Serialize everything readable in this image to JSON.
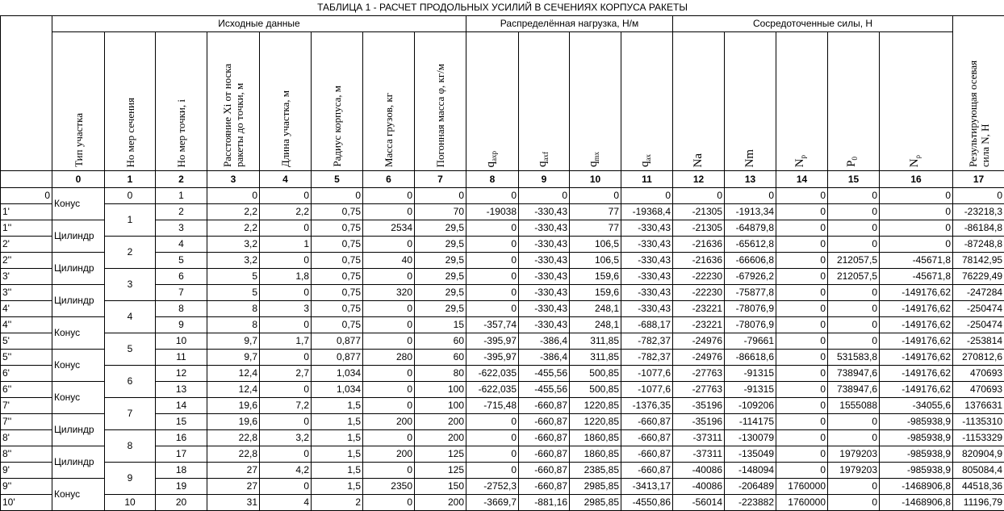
{
  "title": "ТАБЛИЦА 1  - РАСЧЕТ ПРОДОЛЬНЫХ УСИЛИЙ В СЕЧЕНИЯХ КОРПУСА РАКЕТЫ",
  "groups": {
    "source": "Исходные данные",
    "distributed": "Распределённая нагрузка, Н/м",
    "concentrated": "Сосредоточенные силы, Н"
  },
  "headers": [
    {
      "text": "Тип участка"
    },
    {
      "text": "Но мер сечения"
    },
    {
      "text": "Но мер точки, i"
    },
    {
      "text": "Расстояние Xi от носка ракеты до точки, м"
    },
    {
      "text": "Длина участка, м"
    },
    {
      "text": "Радиус корпуса, м"
    },
    {
      "text": "Масса грузов, кг"
    },
    {
      "text": "Погонная масса φ, кг/м"
    },
    {
      "base": "q",
      "sub": "axp"
    },
    {
      "base": "q",
      "sub": "axf"
    },
    {
      "base": "q",
      "sub": "mx"
    },
    {
      "base": "q",
      "sub": "ax"
    },
    {
      "base": "Na",
      "sub": ""
    },
    {
      "base": "Nm",
      "sub": ""
    },
    {
      "base": "N",
      "sub": "p"
    },
    {
      "base": "P",
      "sub": "0"
    },
    {
      "base": "N",
      "sub": "ρ"
    },
    {
      "text": "Результирующая осевая сила N, Н"
    }
  ],
  "index_row": [
    "0",
    "1",
    "2",
    "3",
    "4",
    "5",
    "6",
    "7",
    "8",
    "9",
    "10",
    "11",
    "12",
    "13",
    "14",
    "15",
    "16",
    "17"
  ],
  "segment_types": [
    "Конус",
    "Цилиндр",
    "Цилиндр",
    "Цилиндр",
    "Конус",
    "Конус",
    "Конус",
    "Цилиндр",
    "Цилиндр",
    "Конус"
  ],
  "sections": [
    "0",
    "1",
    "2",
    "3",
    "4",
    "5",
    "6",
    "7",
    "8",
    "9",
    "10"
  ],
  "rows": [
    {
      "label": "0",
      "point": "1",
      "v": [
        "0",
        "0",
        "0",
        "0",
        "0",
        "0",
        "0",
        "0",
        "0",
        "0",
        "0",
        "0",
        "0",
        "0",
        "0"
      ]
    },
    {
      "label": "1'",
      "point": "2",
      "v": [
        "2,2",
        "2,2",
        "0,75",
        "0",
        "70",
        "-19038",
        "-330,43",
        "77",
        "-19368,4",
        "-21305",
        "-1913,34",
        "0",
        "0",
        "0",
        "-23218,3"
      ]
    },
    {
      "label": "1''",
      "point": "3",
      "v": [
        "2,2",
        "0",
        "0,75",
        "2534",
        "29,5",
        "0",
        "-330,43",
        "77",
        "-330,43",
        "-21305",
        "-64879,8",
        "0",
        "0",
        "0",
        "-86184,8"
      ]
    },
    {
      "label": "2'",
      "point": "4",
      "v": [
        "3,2",
        "1",
        "0,75",
        "0",
        "29,5",
        "0",
        "-330,43",
        "106,5",
        "-330,43",
        "-21636",
        "-65612,8",
        "0",
        "0",
        "0",
        "-87248,8"
      ]
    },
    {
      "label": "2''",
      "point": "5",
      "v": [
        "3,2",
        "0",
        "0,75",
        "40",
        "29,5",
        "0",
        "-330,43",
        "106,5",
        "-330,43",
        "-21636",
        "-66606,8",
        "0",
        "212057,5",
        "-45671,8",
        "78142,95"
      ]
    },
    {
      "label": "3'",
      "point": "6",
      "v": [
        "5",
        "1,8",
        "0,75",
        "0",
        "29,5",
        "0",
        "-330,43",
        "159,6",
        "-330,43",
        "-22230",
        "-67926,2",
        "0",
        "212057,5",
        "-45671,8",
        "76229,49"
      ]
    },
    {
      "label": "3''",
      "point": "7",
      "v": [
        "5",
        "0",
        "0,75",
        "320",
        "29,5",
        "0",
        "-330,43",
        "159,6",
        "-330,43",
        "-22230",
        "-75877,8",
        "0",
        "0",
        "-149176,62",
        "-247284"
      ]
    },
    {
      "label": "4'",
      "point": "8",
      "v": [
        "8",
        "3",
        "0,75",
        "0",
        "29,5",
        "0",
        "-330,43",
        "248,1",
        "-330,43",
        "-23221",
        "-78076,9",
        "0",
        "0",
        "-149176,62",
        "-250474"
      ]
    },
    {
      "label": "4''",
      "point": "9",
      "v": [
        "8",
        "0",
        "0,75",
        "0",
        "15",
        "-357,74",
        "-330,43",
        "248,1",
        "-688,17",
        "-23221",
        "-78076,9",
        "0",
        "0",
        "-149176,62",
        "-250474"
      ]
    },
    {
      "label": "5'",
      "point": "10",
      "v": [
        "9,7",
        "1,7",
        "0,877",
        "0",
        "60",
        "-395,97",
        "-386,4",
        "311,85",
        "-782,37",
        "-24976",
        "-79661",
        "0",
        "0",
        "-149176,62",
        "-253814"
      ]
    },
    {
      "label": "5''",
      "point": "11",
      "v": [
        "9,7",
        "0",
        "0,877",
        "280",
        "60",
        "-395,97",
        "-386,4",
        "311,85",
        "-782,37",
        "-24976",
        "-86618,6",
        "0",
        "531583,8",
        "-149176,62",
        "270812,6"
      ]
    },
    {
      "label": "6'",
      "point": "12",
      "v": [
        "12,4",
        "2,7",
        "1,034",
        "0",
        "80",
        "-622,035",
        "-455,56",
        "500,85",
        "-1077,6",
        "-27763",
        "-91315",
        "0",
        "738947,6",
        "-149176,62",
        "470693"
      ]
    },
    {
      "label": "6''",
      "point": "13",
      "v": [
        "12,4",
        "0",
        "1,034",
        "0",
        "100",
        "-622,035",
        "-455,56",
        "500,85",
        "-1077,6",
        "-27763",
        "-91315",
        "0",
        "738947,6",
        "-149176,62",
        "470693"
      ]
    },
    {
      "label": "7'",
      "point": "14",
      "v": [
        "19,6",
        "7,2",
        "1,5",
        "0",
        "100",
        "-715,48",
        "-660,87",
        "1220,85",
        "-1376,35",
        "-35196",
        "-109206",
        "0",
        "1555088",
        "-34055,6",
        "1376631"
      ]
    },
    {
      "label": "7''",
      "point": "15",
      "v": [
        "19,6",
        "0",
        "1,5",
        "200",
        "200",
        "0",
        "-660,87",
        "1220,85",
        "-660,87",
        "-35196",
        "-114175",
        "0",
        "0",
        "-985938,9",
        "-1135310"
      ]
    },
    {
      "label": "8'",
      "point": "16",
      "v": [
        "22,8",
        "3,2",
        "1,5",
        "0",
        "200",
        "0",
        "-660,87",
        "1860,85",
        "-660,87",
        "-37311",
        "-130079",
        "0",
        "0",
        "-985938,9",
        "-1153329"
      ]
    },
    {
      "label": "8''",
      "point": "17",
      "v": [
        "22,8",
        "0",
        "1,5",
        "200",
        "125",
        "0",
        "-660,87",
        "1860,85",
        "-660,87",
        "-37311",
        "-135049",
        "0",
        "1979203",
        "-985938,9",
        "820904,9"
      ]
    },
    {
      "label": "9'",
      "point": "18",
      "v": [
        "27",
        "4,2",
        "1,5",
        "0",
        "125",
        "0",
        "-660,87",
        "2385,85",
        "-660,87",
        "-40086",
        "-148094",
        "0",
        "1979203",
        "-985938,9",
        "805084,4"
      ]
    },
    {
      "label": "9''",
      "point": "19",
      "v": [
        "27",
        "0",
        "1,5",
        "2350",
        "150",
        "-2752,3",
        "-660,87",
        "2985,85",
        "-3413,17",
        "-40086",
        "-206489",
        "1760000",
        "0",
        "-1468906,8",
        "44518,36"
      ]
    },
    {
      "label": "10'",
      "point": "20",
      "v": [
        "31",
        "4",
        "2",
        "0",
        "200",
        "-3669,7",
        "-881,16",
        "2985,85",
        "-4550,86",
        "-56014",
        "-223882",
        "1760000",
        "0",
        "-1468906,8",
        "11196,79"
      ]
    }
  ]
}
